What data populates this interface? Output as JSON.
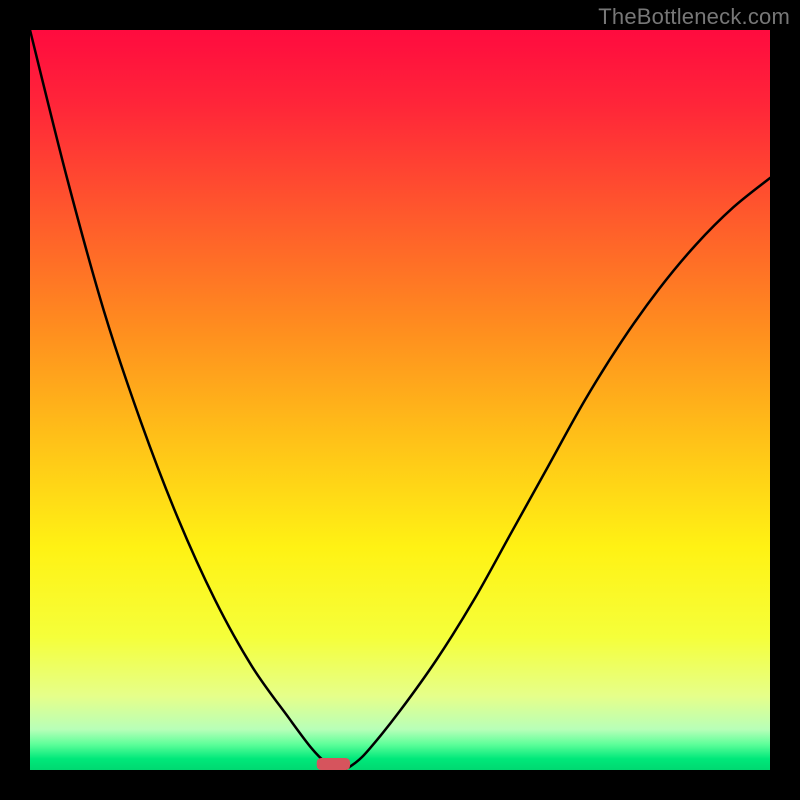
{
  "watermark": "TheBottleneck.com",
  "chart_data": {
    "type": "line",
    "title": "",
    "xlabel": "",
    "ylabel": "",
    "xlim": [
      0,
      100
    ],
    "ylim": [
      0,
      100
    ],
    "x": [
      0,
      5,
      10,
      15,
      20,
      25,
      30,
      35,
      38,
      40,
      42,
      44,
      46,
      50,
      55,
      60,
      65,
      70,
      75,
      80,
      85,
      90,
      95,
      100
    ],
    "values": [
      100,
      80,
      62,
      47,
      34,
      23,
      14,
      7,
      3,
      1,
      0,
      1,
      3,
      8,
      15,
      23,
      32,
      41,
      50,
      58,
      65,
      71,
      76,
      80
    ],
    "curve_color": "#000000",
    "gradient_stops": [
      {
        "offset": 0.0,
        "color": "#ff0b3f"
      },
      {
        "offset": 0.1,
        "color": "#ff2539"
      },
      {
        "offset": 0.25,
        "color": "#ff592c"
      },
      {
        "offset": 0.4,
        "color": "#ff8c1f"
      },
      {
        "offset": 0.55,
        "color": "#ffc018"
      },
      {
        "offset": 0.7,
        "color": "#fff214"
      },
      {
        "offset": 0.82,
        "color": "#f5ff3a"
      },
      {
        "offset": 0.9,
        "color": "#e6ff8a"
      },
      {
        "offset": 0.945,
        "color": "#b8ffb8"
      },
      {
        "offset": 0.965,
        "color": "#5fff9a"
      },
      {
        "offset": 0.985,
        "color": "#00e87a"
      },
      {
        "offset": 1.0,
        "color": "#00d871"
      }
    ],
    "marker": {
      "x": 41,
      "width": 4.5,
      "color": "#d6545d",
      "radius": 2.2
    }
  }
}
